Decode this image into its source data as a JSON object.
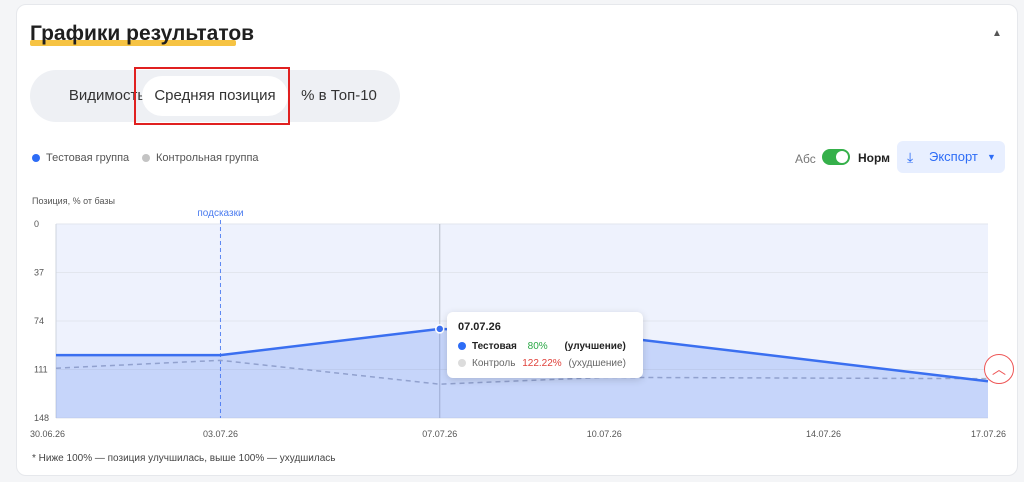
{
  "section": {
    "title": "Графики результатов"
  },
  "tabs": [
    {
      "label": "Видимость"
    },
    {
      "label": "Средняя позиция"
    },
    {
      "label": "% в Топ-10"
    }
  ],
  "legend": [
    {
      "label": "Тестовая группа",
      "color": "#2d6cf6"
    },
    {
      "label": "Контрольная группа",
      "color": "#c4c4c4"
    }
  ],
  "controls": {
    "abs_label": "Абс",
    "norm_label": "Норм",
    "export_label": "Экспорт",
    "toggle_state": "Норм"
  },
  "colors": {
    "test": "#3a6ff0",
    "control": "#a9b0c4",
    "improve": "#2aa845",
    "worsen": "#e0413a",
    "accent": "#2d6cf6"
  },
  "chart_data": {
    "type": "line",
    "ylabel": "Позиция, % от базы",
    "y_ticks": [
      "0",
      "37",
      "74",
      "111",
      "148"
    ],
    "ylim": [
      0,
      148
    ],
    "y_inverted": true,
    "x": [
      "30.06.26",
      "03.07.26",
      "07.07.26",
      "10.07.26",
      "14.07.26",
      "17.07.26"
    ],
    "annotation": {
      "label": "подсказки",
      "x": "03.07.26"
    },
    "series": [
      {
        "name": "Тестовая",
        "points": [
          [
            "30.06.26",
            100
          ],
          [
            "03.07.26",
            100
          ],
          [
            "07.07.26",
            80
          ],
          [
            "10.07.26",
            85
          ],
          [
            "17.07.26",
            120
          ]
        ]
      },
      {
        "name": "Контроль",
        "points": [
          [
            "30.06.26",
            110
          ],
          [
            "03.07.26",
            104
          ],
          [
            "07.07.26",
            122.22
          ],
          [
            "10.07.26",
            117
          ],
          [
            "17.07.26",
            118
          ]
        ]
      }
    ],
    "tooltip": {
      "date": "07.07.26",
      "rows": [
        {
          "name": "Тестовая",
          "value": "80%",
          "status": "(улучшение)"
        },
        {
          "name": "Контроль",
          "value": "122.22%",
          "status": "(ухудшение)"
        }
      ]
    },
    "footnote": "* Ниже 100% — позиция улучшилась, выше 100% — ухудшилась"
  }
}
